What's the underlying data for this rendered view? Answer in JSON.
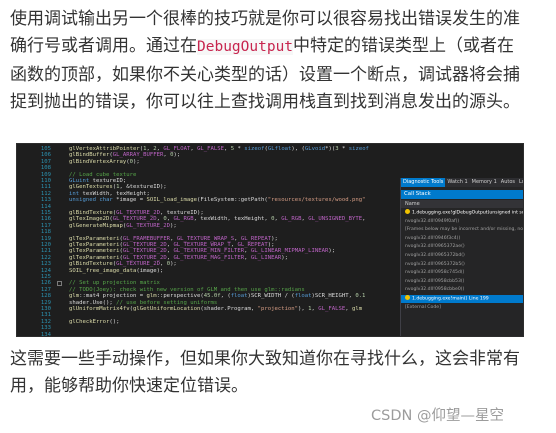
{
  "paragraph_top": {
    "part1": "使用调试输出另一个很棒的技巧就是你可以很容易找出错误发生的准确行号或者调用。通过在",
    "code": "DebugOutput",
    "part2": "中特定的错误类型上（或者在函数的顶部，如果你不关心类型的话）设置一个断点，调试器将会捕捉到抛出的错误，你可以往上查找调用栈直到找到消息发出的源头。"
  },
  "screenshot": {
    "line_numbers": [
      "105",
      "106",
      "107",
      "108",
      "109",
      "110",
      "111",
      "112",
      "113",
      "114",
      "115",
      "116",
      "117",
      "118",
      "119",
      "120",
      "121",
      "122",
      "123",
      "124",
      "125",
      "126",
      "127",
      "128",
      "129",
      "130",
      "131",
      "132",
      "133",
      "134"
    ],
    "code_lines": [
      "glVertexAttribPointer(1, 2, GL_FLOAT, GL_FALSE, 5 * sizeof(GLfloat), (GLvoid*)(3 * sizeof",
      "glBindBuffer(GL_ARRAY_BUFFER, 0);",
      "glBindVertexArray(0);",
      "",
      "// Load cube texture",
      "GLuint textureID;",
      "glGenTextures(1, &textureID);",
      "int texWidth, texHeight;",
      "unsigned char *image = SOIL_load_image(FileSystem::getPath(\"resources/textures/wood.png\"",
      "",
      "glBindTexture(GL_TEXTURE_2D, textureID);",
      "glTexImage2D(GL_TEXTURE_2D, 0, GL_RGB, texWidth, texHeight, 0, GL_RGB, GL_UNSIGNED_BYTE,",
      "glGenerateMipmap(GL_TEXTURE_2D);",
      "",
      "glTexParameteri(GL_FRAMEBUFFER, GL_TEXTURE_WRAP_S, GL_REPEAT);",
      "glTexParameteri(GL_TEXTURE_2D, GL_TEXTURE_WRAP_T, GL_REPEAT);",
      "glTexParameteri(GL_TEXTURE_2D, GL_TEXTURE_MIN_FILTER, GL_LINEAR_MIPMAP_LINEAR);",
      "glTexParameteri(GL_TEXTURE_2D, GL_TEXTURE_MAG_FILTER, GL_LINEAR);",
      "glBindTexture(GL_TEXTURE_2D, 0);",
      "SOIL_free_image_data(image);",
      "",
      "// Set up projection matrix",
      "// TODO(Joey): check with new version of GLM and then use glm::radians",
      "glm::mat4 projection = glm::perspective(45.0f, (float)SCR_WIDTH / (float)SCR_HEIGHT, 0.1",
      "shader.Use(); // use before setting uniforms",
      "glUniformMatrix4fv(glGetUniformLocation(shader.Program, \"projection\"), 1, GL_FALSE, glm",
      "",
      "glCheckError();",
      "",
      ""
    ],
    "tabs": [
      "Diagnostic Tools",
      "Watch 1",
      "Memory 1",
      "Autos",
      "Locals"
    ],
    "call_stack_title": "Call Stack",
    "call_stack_header": "Name",
    "call_stack_rows": [
      "1.debugging.exe!glDebugOutput(unsigned int source",
      "nvoglv32.dll!0949f0af()",
      "[Frames below may be incorrect and/or missing, no",
      "nvoglv32.dll!0946f3c4()",
      "nvoglv32.dll!0965372ae()",
      "nvoglv32.dll!0965372bd()",
      "nvoglv32.dll!0965372b5()",
      "nvoglv32.dll!0958c745d()",
      "nvoglv32.dll!0958cbb53()",
      "nvoglv32.dll!0958cbbe0()",
      "1.debugging.exe!main() Line 199",
      "[External Code]"
    ]
  },
  "paragraph_bottom": "这需要一些手动操作，但如果你大致知道你在寻找什么，这会非常有用，能够帮助你快速定位错误。",
  "watermark": "CSDN @仰望—星空"
}
